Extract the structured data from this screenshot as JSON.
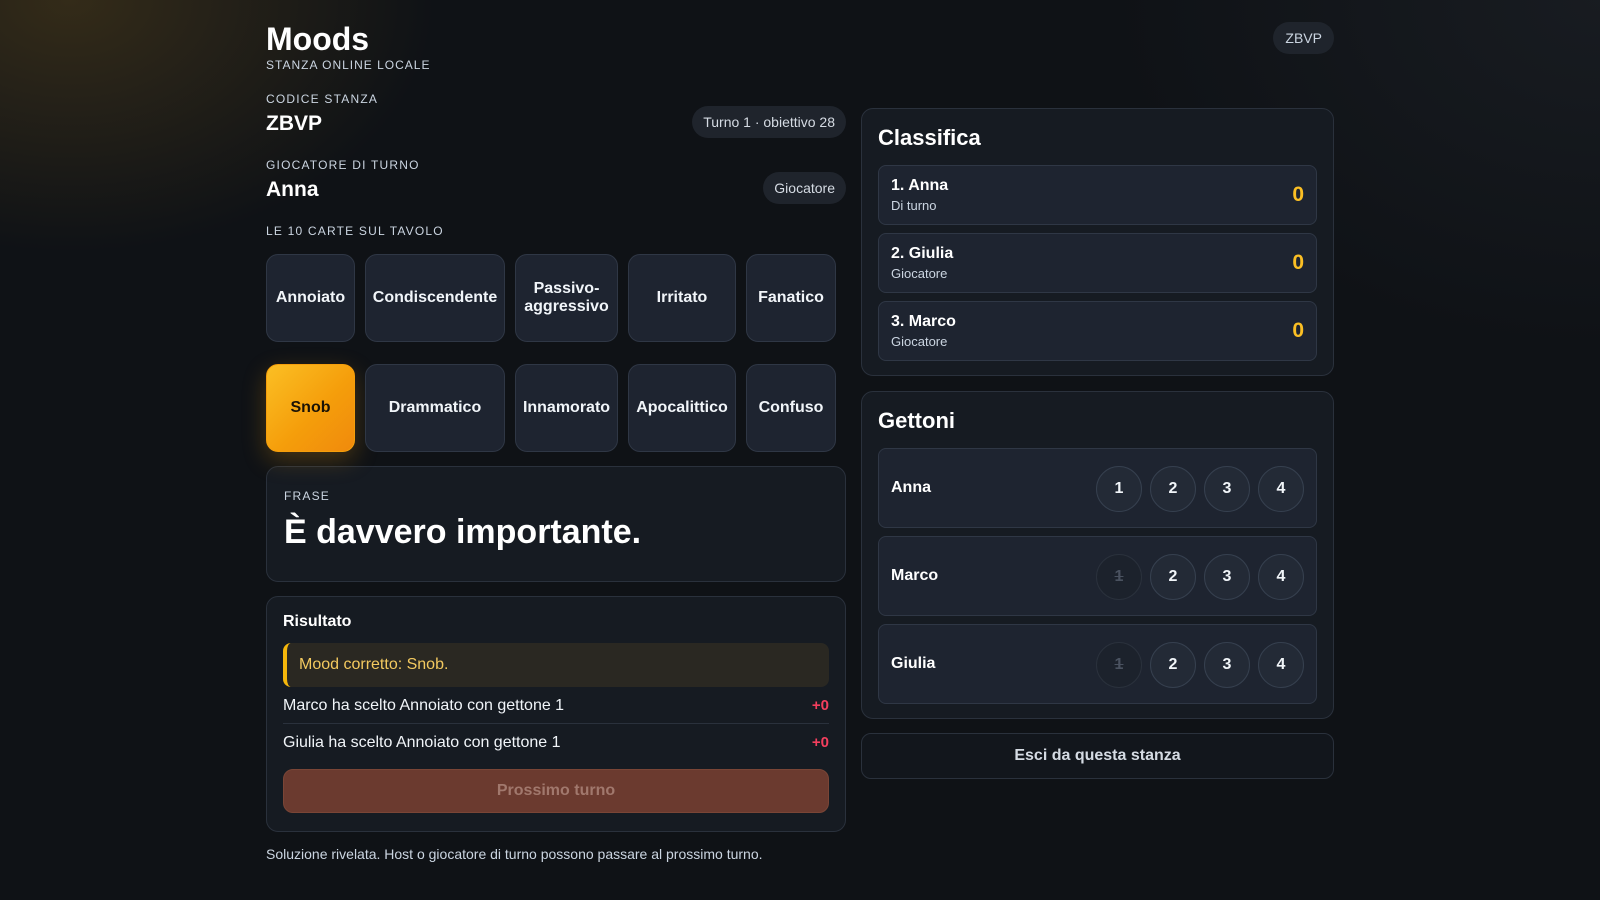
{
  "header": {
    "title": "Moods",
    "subtitle": "STANZA ONLINE LOCALE",
    "room_pill": "ZBVP"
  },
  "room": {
    "code_label": "CODICE STANZA",
    "code": "ZBVP",
    "turn_chip": "Turno 1 · obiettivo 28"
  },
  "turn_player": {
    "label": "GIOCATORE DI TURNO",
    "name": "Anna",
    "role_chip": "Giocatore"
  },
  "cards": {
    "label": "LE 10 CARTE SUL TAVOLO",
    "row1": [
      "Annoiato",
      "Condiscendente",
      "Passivo-aggressivo",
      "Irritato",
      "Fanatico"
    ],
    "row2": [
      "Snob",
      "Drammatico",
      "Innamorato",
      "Apocalittico",
      "Confuso"
    ],
    "selected": "Snob"
  },
  "phrase": {
    "label": "FRASE",
    "text": "È davvero importante."
  },
  "result": {
    "title": "Risultato",
    "alert": "Mood corretto: Snob.",
    "lines": [
      {
        "text": "Marco ha scelto Annoiato con gettone 1",
        "points": "+0"
      },
      {
        "text": "Giulia ha scelto Annoiato con gettone 1",
        "points": "+0"
      }
    ],
    "next_button": "Prossimo turno"
  },
  "footer_note": "Soluzione rivelata. Host o giocatore di turno possono passare al prossimo turno.",
  "ranking": {
    "title": "Classifica",
    "items": [
      {
        "name": "1. Anna",
        "role": "Di turno",
        "score": "0"
      },
      {
        "name": "2. Giulia",
        "role": "Giocatore",
        "score": "0"
      },
      {
        "name": "3. Marco",
        "role": "Giocatore",
        "score": "0"
      }
    ]
  },
  "tokens": {
    "title": "Gettoni",
    "rows": [
      {
        "name": "Anna",
        "tokens": [
          "1",
          "2",
          "3",
          "4"
        ]
      },
      {
        "name": "Marco",
        "tokens": [
          "1",
          "2",
          "3",
          "4"
        ]
      },
      {
        "name": "Giulia",
        "tokens": [
          "1",
          "2",
          "3",
          "4"
        ]
      }
    ]
  },
  "leave_button": "Esci da questa stanza",
  "colors": {
    "accent": "#f59e0b",
    "score": "#fbbf24",
    "negative": "#f43f5e",
    "background": "#0f1216"
  }
}
